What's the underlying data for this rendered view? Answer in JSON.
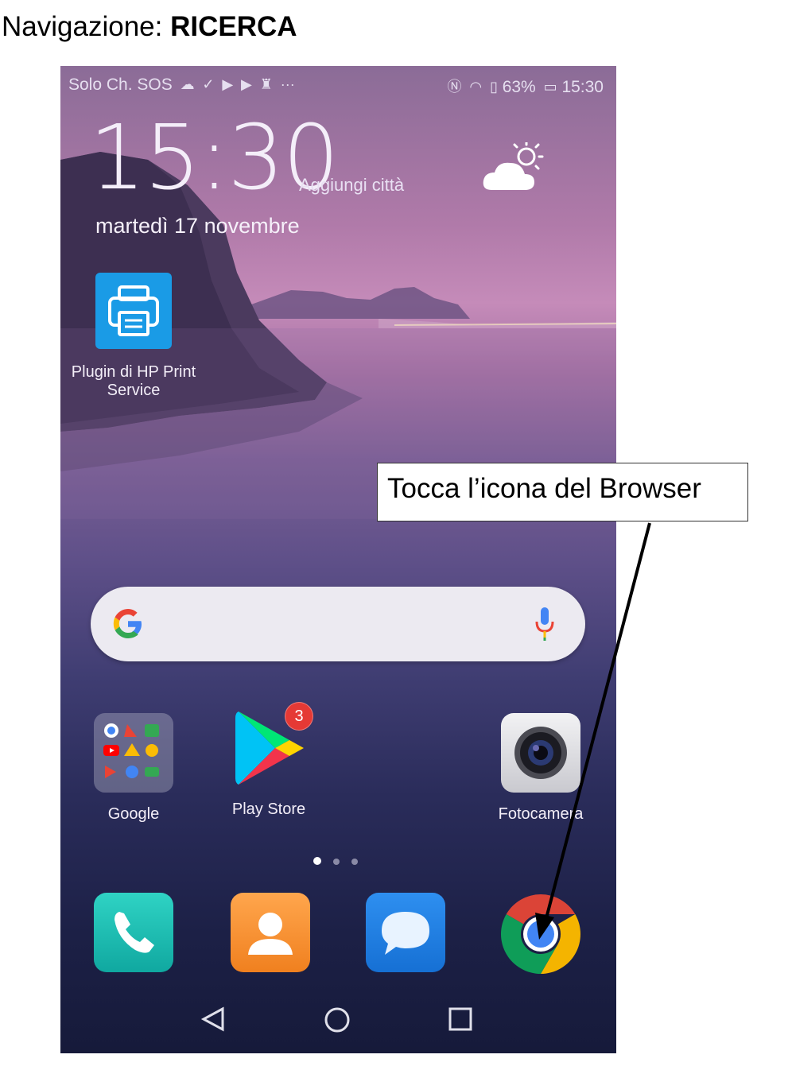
{
  "document": {
    "title_prefix": "Navigazione: ",
    "title_bold": "RICERCA"
  },
  "status_bar": {
    "carrier": "Solo Ch. SOS",
    "left_icons": [
      "cloud-icon",
      "download-icon",
      "play-icon",
      "play-icon",
      "key-icon",
      "more-icon"
    ],
    "right_icons": [
      "nfc-icon",
      "wifi-icon",
      "battery-saver-icon"
    ],
    "battery": "63%",
    "time": "15:30"
  },
  "lockscreen": {
    "clock": "15:30",
    "add_city": "Aggiungi città",
    "date": "martedì 17 novembre",
    "weather_icon": "partly-cloudy-icon"
  },
  "widget_app": {
    "label_line1": "Plugin di HP Print",
    "label_line2": "Service",
    "icon": "printer-icon"
  },
  "search_bar": {
    "logo": "google-g-icon",
    "mic": "mic-icon"
  },
  "apps": [
    {
      "label": "Google",
      "icon": "google-folder-icon"
    },
    {
      "label": "Play Store",
      "icon": "play-store-icon",
      "badge": "3"
    },
    {
      "label": "Fotocamera",
      "icon": "camera-icon"
    }
  ],
  "page_indicator": {
    "pages": 3,
    "active": 1
  },
  "dock": [
    {
      "icon": "phone-icon"
    },
    {
      "icon": "contacts-icon"
    },
    {
      "icon": "messages-icon"
    },
    {
      "icon": "chrome-icon"
    }
  ],
  "navigation": [
    "back-icon",
    "home-icon",
    "recents-icon"
  ],
  "callout": {
    "text": "Tocca l’icona del Browser"
  },
  "colors": {
    "accent_blue": "#1a9be6",
    "badge_red": "#e53935"
  }
}
